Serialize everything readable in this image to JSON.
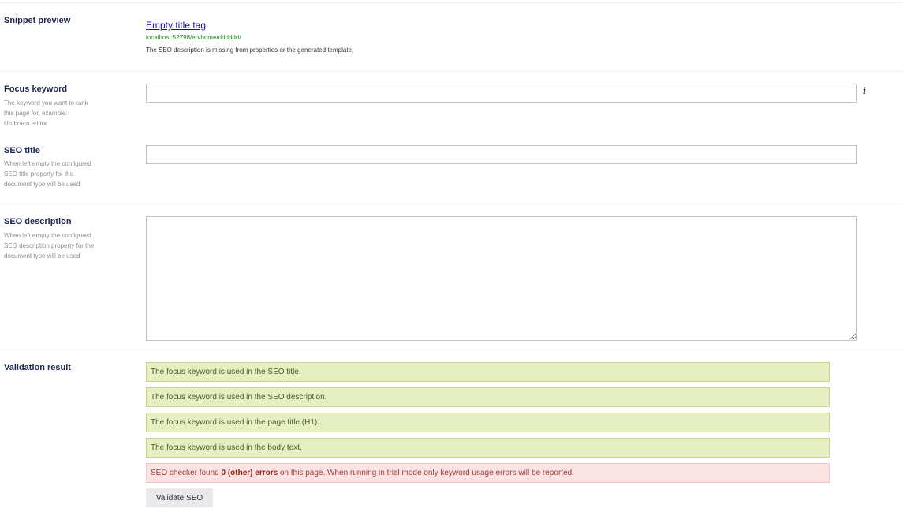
{
  "snippet_preview": {
    "label": "Snippet preview",
    "title": "Empty title tag",
    "url": "localhost:52798/en/home/dddddd/",
    "description": "The SEO description is missing from properties or the generated template."
  },
  "focus_keyword": {
    "label": "Focus keyword",
    "description": "The keyword you want to rank this page for, example: Umbraco editor",
    "value": "",
    "info_icon": "info-icon"
  },
  "seo_title": {
    "label": "SEO title",
    "description": "When left empty the configured SEO title property for the document type will be used",
    "value": ""
  },
  "seo_description": {
    "label": "SEO description",
    "description": "When left empty the configured SEO description property for the document type will be used",
    "value": ""
  },
  "validation": {
    "label": "Validation result",
    "success_messages": [
      "The focus keyword is used in the SEO title.",
      "The focus keyword is used in the SEO description.",
      "The focus keyword is used in the page title (H1).",
      "The focus keyword is used in the body text."
    ],
    "error_prefix": "SEO checker found ",
    "error_bold": "0 (other) errors",
    "error_suffix": " on this page. When running in trial mode only keyword usage errors will be reported.",
    "button_label": "Validate SEO"
  },
  "colors": {
    "success_bg": "#e6efc2",
    "error_bg": "#fbe3e4",
    "link": "#1a0dab",
    "url": "#1e8b1e"
  }
}
